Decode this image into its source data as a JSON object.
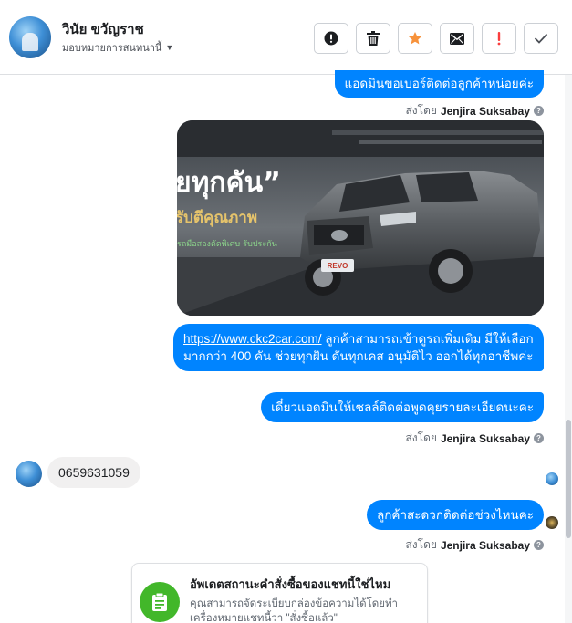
{
  "header": {
    "name": "วินัย ขวัญราช",
    "assign_label": "มอบหมายการสนทนานี้",
    "actions": [
      {
        "name": "mark-spam-button",
        "icon": "alert-circle-icon"
      },
      {
        "name": "delete-button",
        "icon": "trash-icon"
      },
      {
        "name": "star-button",
        "icon": "star-icon"
      },
      {
        "name": "mark-unread-button",
        "icon": "envelope-icon"
      },
      {
        "name": "follow-up-button",
        "icon": "exclamation-icon"
      },
      {
        "name": "mark-done-button",
        "icon": "check-icon"
      }
    ]
  },
  "messages": {
    "msg1": "แอดมินขอเบอร์ติดต่อลูกค้าหน่อยค่ะ",
    "sent_by_prefix": "ส่งโดย",
    "sender": "Jenjira Suksabay",
    "image": {
      "headline": "ยทุกคัน”",
      "subline": "รับตีคุณภาพ",
      "small": "รถมือสองคัดพิเศษ รับประกัน",
      "plate": "REVO"
    },
    "msg2_link": "https://www.ckc2car.com/",
    "msg2_text": " ลูกค้าสามารถเข้าดูรถเพิ่มเติม มีให้เลือกมากกว่า 400 คัน ช่วยทุกฝัน ดันทุกเคส อนุมัติไว ออกได้ทุกอาชีพค่ะ",
    "msg3": "เดี๋ยวแอดมินให้เซลล์ติดต่อพูดคุยรายละเอียดนะคะ",
    "incoming": "0659631059",
    "msg4": "ลูกค้าสะดวกติดต่อช่วงไหนคะ"
  },
  "order_card": {
    "title": "อัพเดตสถานะคำสั่งซื้อของแชทนี้ใช่ไหม",
    "desc": "คุณสามารถจัดระเบียบกล่องข้อความได้โดยทำเครื่องหมายแชทนี้ว่า \"สั่งซื้อแล้ว\""
  },
  "colors": {
    "accent": "#0084ff",
    "incoming_bg": "#f1f0f0",
    "star": "#f7923b",
    "flag": "#fa3e3e",
    "success": "#42b72a"
  }
}
